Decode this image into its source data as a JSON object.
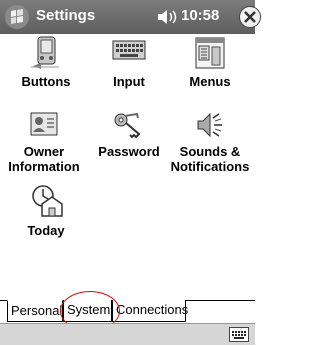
{
  "title_bar": {
    "title": "Settings",
    "time": "10:58"
  },
  "icons": [
    "windows-flag-icon",
    "speaker-icon",
    "close-icon",
    "keyboard-icon"
  ],
  "tiles": [
    {
      "label": "Buttons",
      "icon": "buttons-icon"
    },
    {
      "label": "Input",
      "icon": "keyboard-icon"
    },
    {
      "label": "Menus",
      "icon": "menus-icon"
    },
    {
      "label_line1": "Owner",
      "label_line2": "Information",
      "icon": "owner-information-icon"
    },
    {
      "label": "Password",
      "icon": "password-keys-icon"
    },
    {
      "label_line1": "Sounds &",
      "label_line2": "Notifications",
      "icon": "sounds-notifications-icon"
    },
    {
      "label": "Today",
      "icon": "today-clock-icon"
    }
  ],
  "tabs": [
    {
      "label": "Personal",
      "selected": true
    },
    {
      "label": "System",
      "selected": false,
      "highlighted": true
    },
    {
      "label": "Connections",
      "selected": false
    }
  ],
  "colors": {
    "title_bar": "#6b6b6b",
    "annotation_circle": "#d01010",
    "command_bar": "#d6d6d6"
  }
}
